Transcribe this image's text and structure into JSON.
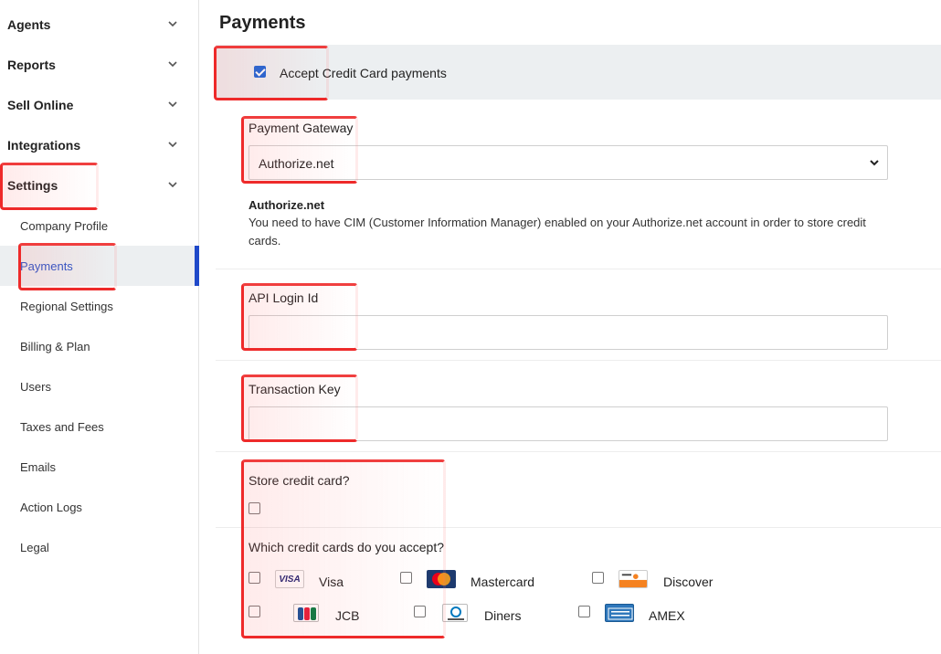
{
  "sidebar": {
    "groups": [
      {
        "label": "Agents"
      },
      {
        "label": "Reports"
      },
      {
        "label": "Sell Online"
      },
      {
        "label": "Integrations"
      },
      {
        "label": "Settings"
      }
    ],
    "settings_items": [
      {
        "label": "Company Profile"
      },
      {
        "label": "Payments"
      },
      {
        "label": "Regional Settings"
      },
      {
        "label": "Billing & Plan"
      },
      {
        "label": "Users"
      },
      {
        "label": "Taxes and Fees"
      },
      {
        "label": "Emails"
      },
      {
        "label": "Action Logs"
      },
      {
        "label": "Legal"
      }
    ],
    "active_item": "Payments"
  },
  "page": {
    "title": "Payments",
    "accept_cc": {
      "label": "Accept Credit Card payments",
      "checked": true
    },
    "gateway": {
      "label": "Payment Gateway",
      "selected": "Authorize.net",
      "info_title": "Authorize.net",
      "info_text": "You need to have CIM (Customer Information Manager) enabled on your Authorize.net account in order to store credit cards."
    },
    "api_login": {
      "label": "API Login Id",
      "value": ""
    },
    "transaction_key": {
      "label": "Transaction Key",
      "value": ""
    },
    "store_card": {
      "label": "Store credit card?",
      "checked": false
    },
    "cards": {
      "label": "Which credit cards do you accept?",
      "items": [
        {
          "name": "Visa",
          "logo_text": "VISA",
          "checked": false
        },
        {
          "name": "Mastercard",
          "logo_text": "MasterCard",
          "checked": false
        },
        {
          "name": "Discover",
          "logo_text": "DISCOVER",
          "checked": false
        },
        {
          "name": "JCB",
          "logo_text": "JCB",
          "checked": false
        },
        {
          "name": "Diners",
          "logo_text": "Diners",
          "checked": false
        },
        {
          "name": "AMEX",
          "logo_text": "AMEX",
          "checked": false
        }
      ]
    }
  },
  "colors": {
    "accent": "#1f49c9",
    "checkbox_checked": "#1d64d6",
    "highlight": "#ee2a2a",
    "row_bg": "#eceff1"
  }
}
